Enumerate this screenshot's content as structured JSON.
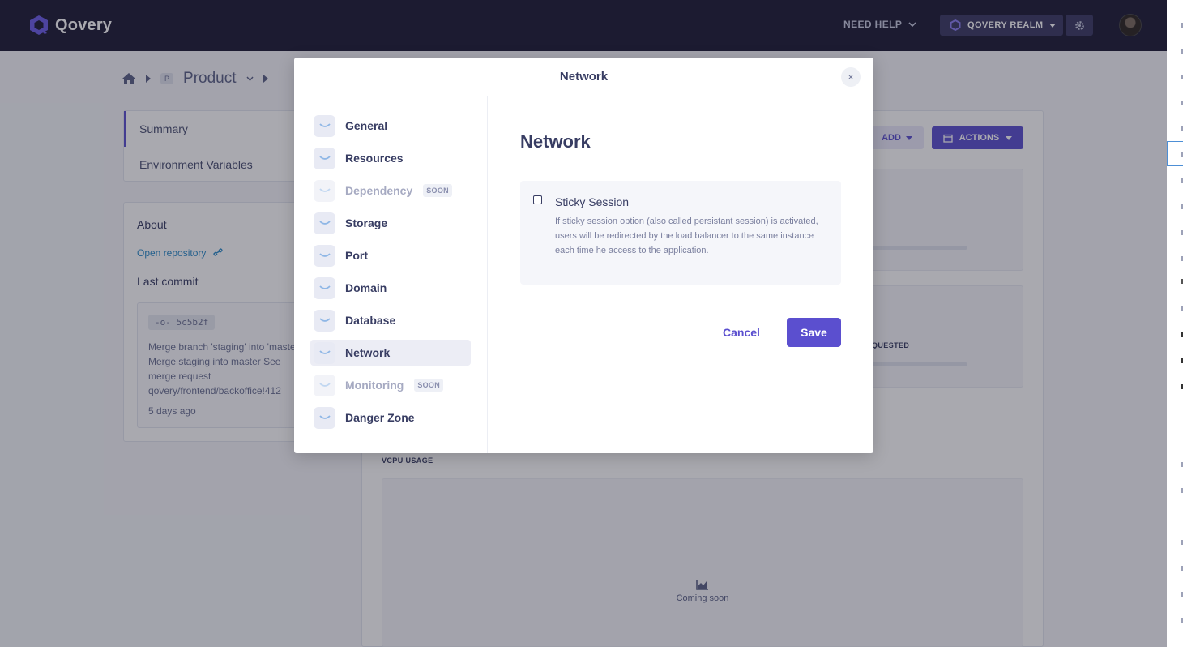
{
  "topbar": {
    "logo_text": "Qovery",
    "need_help": "NEED HELP",
    "realm": "QOVERY REALM"
  },
  "breadcrumb": {
    "project_badge": "P",
    "project": "Product"
  },
  "left_nav": {
    "items": [
      {
        "label": "Summary"
      },
      {
        "label": "Environment Variables"
      }
    ]
  },
  "about": {
    "title": "About",
    "open_repo": "Open repository",
    "last_commit": "Last commit",
    "commit_sha": "-o- 5c5b2f",
    "commit_message": "Merge branch 'staging' into 'master' Merge staging into master See merge request qovery/frontend/backoffice!412",
    "commit_age": "5 days ago"
  },
  "main": {
    "add": "ADD",
    "actions": "ACTIONS",
    "requested": "QUESTED",
    "vcpu_usage": "VCPU USAGE",
    "coming_soon": "Coming soon"
  },
  "modal": {
    "title": "Network",
    "close": "×",
    "menu": [
      {
        "label": "General",
        "disabled": false,
        "badge": ""
      },
      {
        "label": "Resources",
        "disabled": false,
        "badge": ""
      },
      {
        "label": "Dependency",
        "disabled": true,
        "badge": "SOON"
      },
      {
        "label": "Storage",
        "disabled": false,
        "badge": ""
      },
      {
        "label": "Port",
        "disabled": false,
        "badge": ""
      },
      {
        "label": "Domain",
        "disabled": false,
        "badge": ""
      },
      {
        "label": "Database",
        "disabled": false,
        "badge": ""
      },
      {
        "label": "Network",
        "disabled": false,
        "badge": "",
        "active": true
      },
      {
        "label": "Monitoring",
        "disabled": true,
        "badge": "SOON"
      },
      {
        "label": "Danger Zone",
        "disabled": false,
        "badge": ""
      }
    ],
    "content_title": "Network",
    "sticky_session": {
      "title": "Sticky Session",
      "description": "If sticky session option (also called persistant session) is activated, users will be redirected by the load balancer to the same instance each time he access to the application.",
      "checked": false
    },
    "cancel": "Cancel",
    "save": "Save"
  },
  "colors": {
    "primary": "#5b4fcf",
    "topbar": "#1c1a35",
    "text": "#383d63"
  }
}
